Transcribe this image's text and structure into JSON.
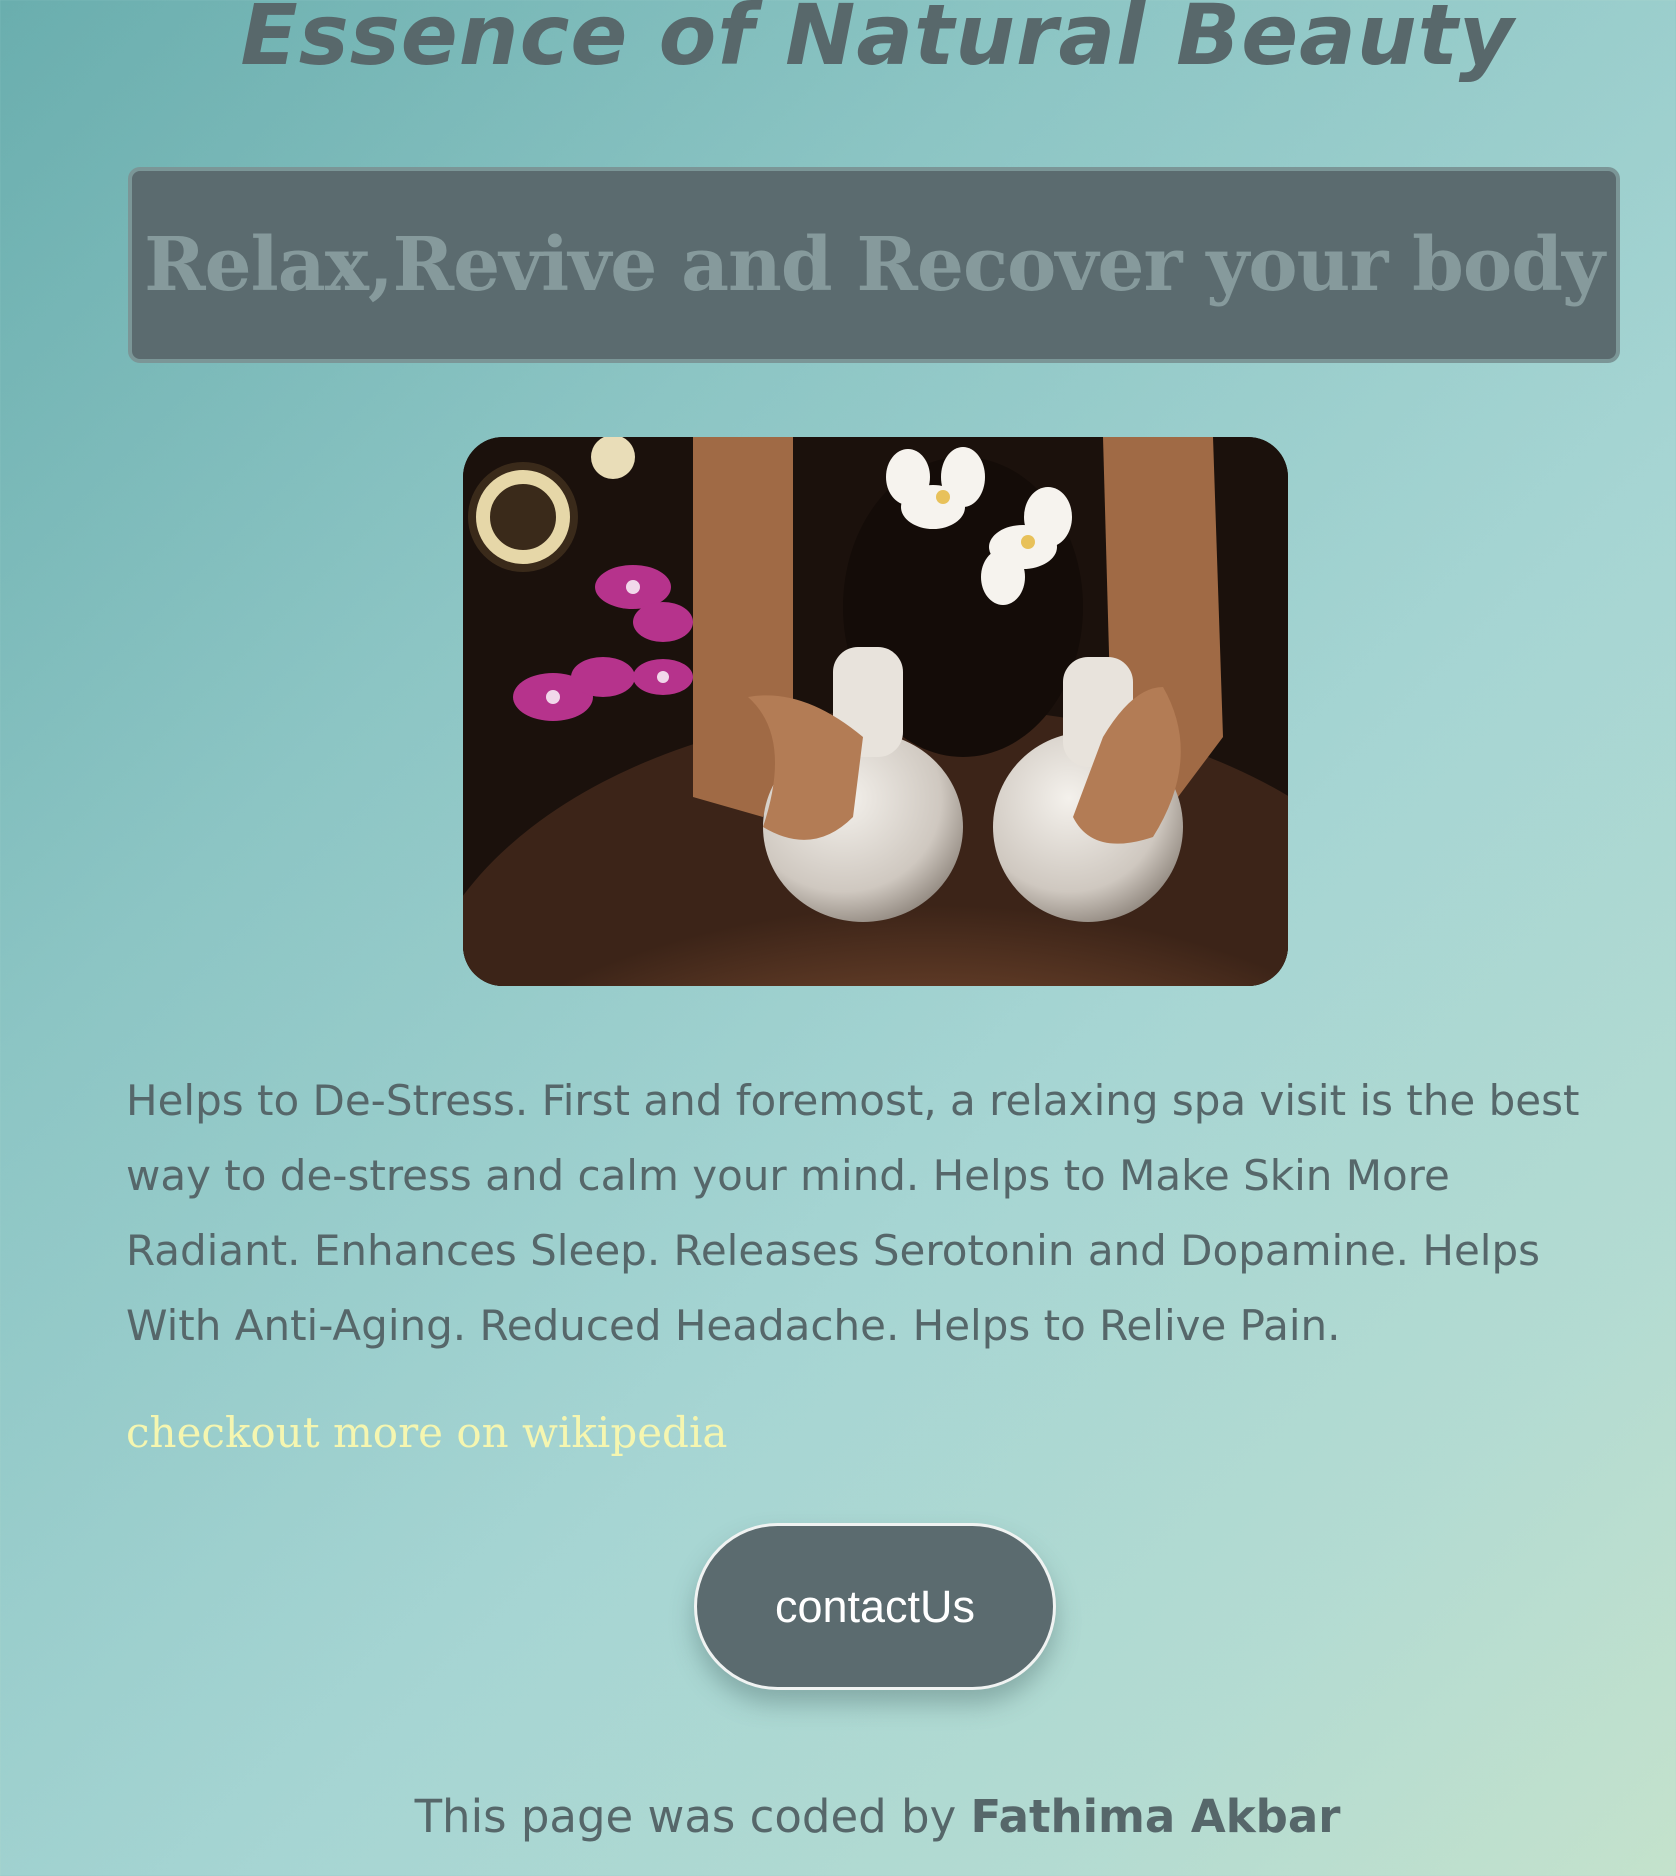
{
  "header": {
    "title": "Essence of Natural Beauty"
  },
  "tagline": {
    "text": "Relax,Revive and Recover your body"
  },
  "description": {
    "text": "Helps to De-Stress. First and foremost, a relaxing spa visit is the best way to de-stress and calm your mind. Helps to Make Skin More Radiant. Enhances Sleep. Releases Serotonin and Dopamine. Helps With Anti-Aging. Reduced Headache. Helps to Relive Pain."
  },
  "link": {
    "label": "checkout more on wikipedia"
  },
  "contact_button": {
    "label": "contactUs"
  },
  "footer": {
    "prefix": "This page was coded by ",
    "author": "Fathima  Akbar"
  },
  "colors": {
    "text": "#56676a",
    "box_background": "#5b6b6f",
    "link": "#f5f6b0",
    "button_text": "#ffffff"
  }
}
